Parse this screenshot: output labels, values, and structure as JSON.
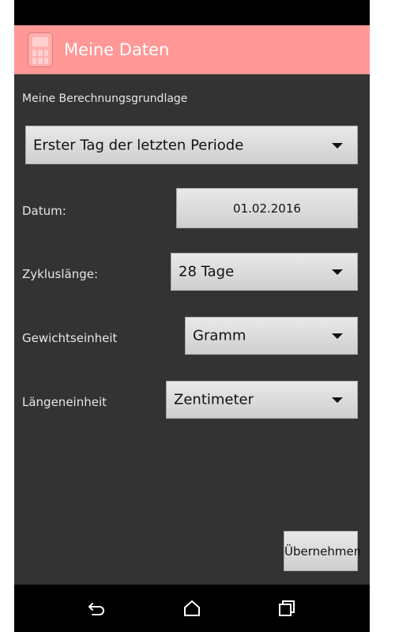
{
  "header": {
    "title": "Meine Daten",
    "icon": "calculator-icon"
  },
  "section": {
    "label": "Meine Berechnungsgrundlage"
  },
  "basis_select": {
    "value": "Erster Tag der letzten Periode"
  },
  "date": {
    "label": "Datum:",
    "value": "01.02.2016"
  },
  "cycle": {
    "label": "Zykluslänge:",
    "value": "28 Tage"
  },
  "weight": {
    "label": "Gewichtseinheit",
    "value": "Gramm"
  },
  "length": {
    "label": "Längeneinheit",
    "value": "Zentimeter"
  },
  "apply_button": {
    "label": "Übernehmen"
  },
  "nav": {
    "back": "back-icon",
    "home": "home-icon",
    "recents": "recents-icon"
  },
  "colors": {
    "action_bar": "#ff9896",
    "background": "#333333"
  }
}
